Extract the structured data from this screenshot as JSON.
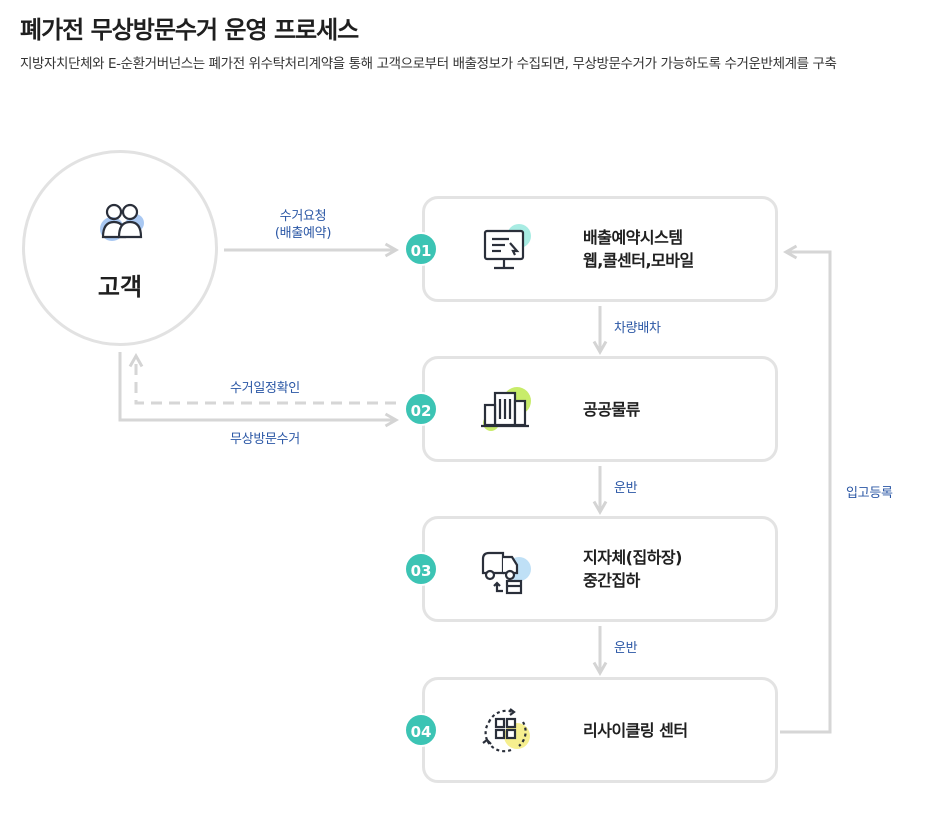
{
  "header": {
    "title": "폐가전 무상방문수거 운영 프로세스",
    "description": "지방자치단체와 E-순환거버넌스는 폐가전 위수탁처리계약을 통해 고객으로부터 배출정보가 수집되면, 무상방문수거가 가능하도록 수거운반체계를 구축"
  },
  "customer": {
    "label": "고객",
    "icon": "people-icon"
  },
  "steps": [
    {
      "num": "01",
      "line1": "배출예약시스템",
      "line2": "웹,콜센터,모바일",
      "icon": "monitor-icon",
      "blob": "#a8ece3"
    },
    {
      "num": "02",
      "line1": "공공물류",
      "line2": "",
      "icon": "building-icon",
      "blob": "#c8ec6a"
    },
    {
      "num": "03",
      "line1": "지자체(집하장)",
      "line2": "중간집하",
      "icon": "truck-icon",
      "blob": "#bfe0f6"
    },
    {
      "num": "04",
      "line1": "리사이클링 센터",
      "line2": "",
      "icon": "recycle-icon",
      "blob": "#f6ef8f"
    }
  ],
  "labels": {
    "request_line1": "수거요청",
    "request_line2": "(배출예약)",
    "dispatch": "차량배차",
    "confirm": "수거일정확인",
    "free_pickup": "무상방문수거",
    "transport1": "운반",
    "transport2": "운반",
    "warehousing": "입고등록"
  },
  "colors": {
    "badge": "#3cc4b4",
    "label": "#2b57a5",
    "border": "#e3e3e3",
    "arrow": "#d6d6d6"
  }
}
